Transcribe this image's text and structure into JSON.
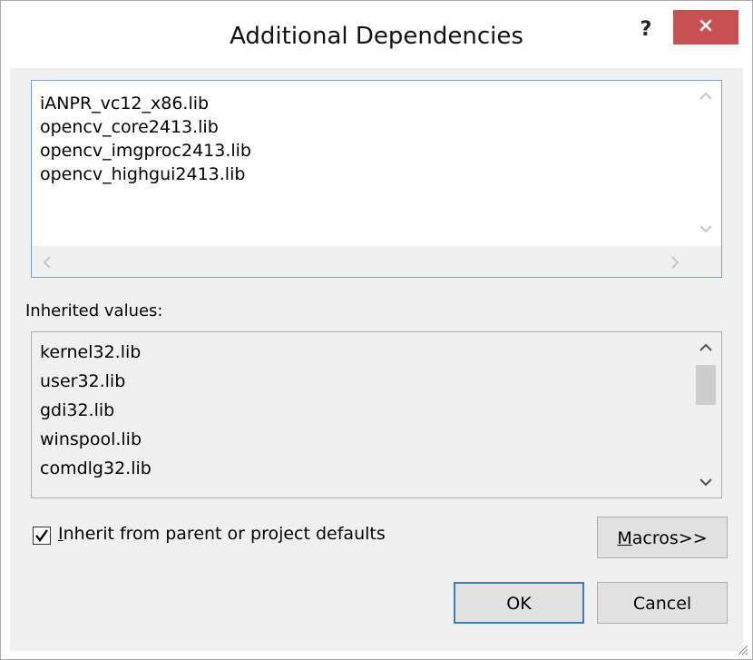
{
  "window": {
    "title": "Additional Dependencies",
    "help_label": "?",
    "close_label": "×"
  },
  "dependencies": {
    "lines": [
      "iANPR_vc12_x86.lib",
      "opencv_core2413.lib",
      "opencv_imgproc2413.lib",
      "opencv_highgui2413.lib"
    ]
  },
  "inherited": {
    "label": "Inherited values:",
    "lines": [
      "kernel32.lib",
      "user32.lib",
      "gdi32.lib",
      "winspool.lib",
      "comdlg32.lib"
    ]
  },
  "inherit_checkbox": {
    "checked": true,
    "label_first": "I",
    "label_rest": "nherit from parent or project defaults"
  },
  "buttons": {
    "macros_mnemonic": "M",
    "macros_rest": "acros>>",
    "ok": "OK",
    "cancel": "Cancel"
  },
  "icons": {
    "scroll_up": "chevron-up-icon",
    "scroll_down": "chevron-down-icon",
    "scroll_left": "chevron-left-icon",
    "scroll_right": "chevron-right-icon",
    "check": "checkmark-icon",
    "grip": "resize-grip-icon"
  },
  "colors": {
    "close_button": "#c75050",
    "default_button_border": "#3c7fb1",
    "edit_border": "#7a9cd3"
  }
}
